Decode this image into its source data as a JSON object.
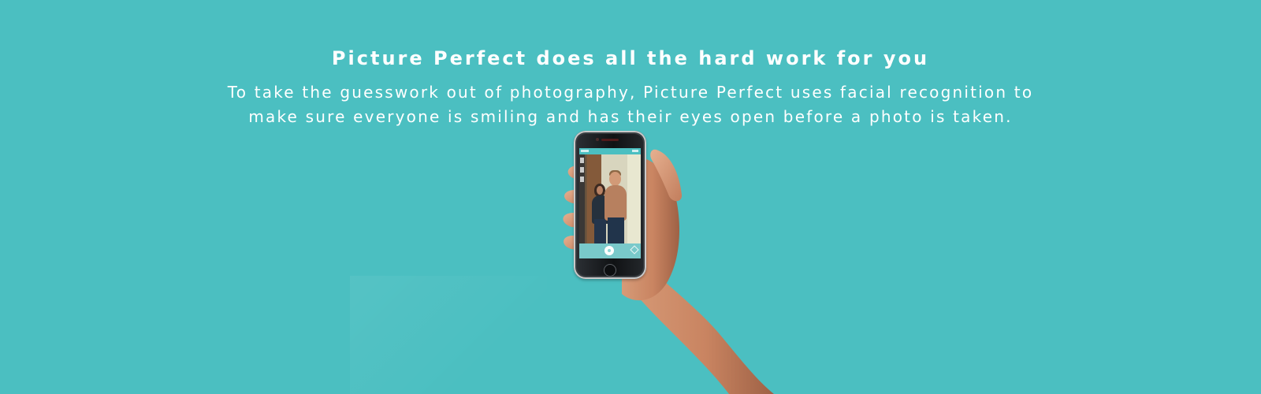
{
  "page": {
    "background_color": "#4bbfc1",
    "text_color": "#ffffff"
  },
  "hero": {
    "headline": "Picture Perfect does all the hard work for you",
    "description_lines": [
      "To take the guesswork out of photography, Picture Perfect uses facial recognition to",
      "make sure everyone is smiling and has their eyes open before a photo is taken."
    ]
  },
  "phone_app": {
    "accent_color": "#4bbfc1",
    "controls": {
      "shutter_icon": "shutter-icon",
      "settings_icon": "settings-icon"
    }
  }
}
